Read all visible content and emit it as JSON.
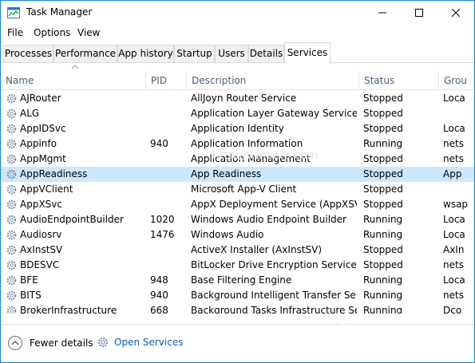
{
  "window": {
    "title": "Task Manager"
  },
  "menu": [
    "File",
    "Options",
    "View"
  ],
  "tabs": [
    {
      "label": "Processes"
    },
    {
      "label": "Performance"
    },
    {
      "label": "App history"
    },
    {
      "label": "Startup"
    },
    {
      "label": "Users"
    },
    {
      "label": "Details"
    },
    {
      "label": "Services",
      "active": true
    }
  ],
  "columns": [
    "Name",
    "PID",
    "Description",
    "Status",
    "Grou"
  ],
  "rows": [
    {
      "name": "AJRouter",
      "pid": "",
      "desc": "AllJoyn Router Service",
      "status": "Stopped",
      "group": "Loca"
    },
    {
      "name": "ALG",
      "pid": "",
      "desc": "Application Layer Gateway Service",
      "status": "Stopped",
      "group": ""
    },
    {
      "name": "AppIDSvc",
      "pid": "",
      "desc": "Application Identity",
      "status": "Stopped",
      "group": "Loca"
    },
    {
      "name": "Appinfo",
      "pid": "940",
      "desc": "Application Information",
      "status": "Running",
      "group": "nets"
    },
    {
      "name": "AppMgmt",
      "pid": "",
      "desc": "Application Management",
      "status": "Stopped",
      "group": "nets"
    },
    {
      "name": "AppReadiness",
      "pid": "",
      "desc": "App Readiness",
      "status": "Stopped",
      "group": "App",
      "selected": true
    },
    {
      "name": "AppVClient",
      "pid": "",
      "desc": "Microsoft App-V Client",
      "status": "Stopped",
      "group": ""
    },
    {
      "name": "AppXSvc",
      "pid": "",
      "desc": "AppX Deployment Service (AppXSVC)",
      "status": "Stopped",
      "group": "wsap"
    },
    {
      "name": "AudioEndpointBuilder",
      "pid": "1020",
      "desc": "Windows Audio Endpoint Builder",
      "status": "Running",
      "group": "Loca"
    },
    {
      "name": "Audiosrv",
      "pid": "1476",
      "desc": "Windows Audio",
      "status": "Running",
      "group": "Loca"
    },
    {
      "name": "AxInstSV",
      "pid": "",
      "desc": "ActiveX Installer (AxInstSV)",
      "status": "Stopped",
      "group": "AxIn"
    },
    {
      "name": "BDESVC",
      "pid": "",
      "desc": "BitLocker Drive Encryption Service",
      "status": "Stopped",
      "group": "nets"
    },
    {
      "name": "BFE",
      "pid": "948",
      "desc": "Base Filtering Engine",
      "status": "Running",
      "group": "Loca"
    },
    {
      "name": "BITS",
      "pid": "940",
      "desc": "Background Intelligent Transfer Servi...",
      "status": "Running",
      "group": "nets"
    },
    {
      "name": "BrokerInfrastructure",
      "pid": "668",
      "desc": "Background Tasks Infrastructure Ser...",
      "status": "Running",
      "group": "Dco"
    }
  ],
  "footer": {
    "fewer_details": "Fewer details",
    "open_services": "Open Services"
  },
  "watermark": "http://winaero.com",
  "colors": {
    "accent": "#1883d7",
    "selection": "#cce8ff",
    "link": "#0b5fb8"
  }
}
